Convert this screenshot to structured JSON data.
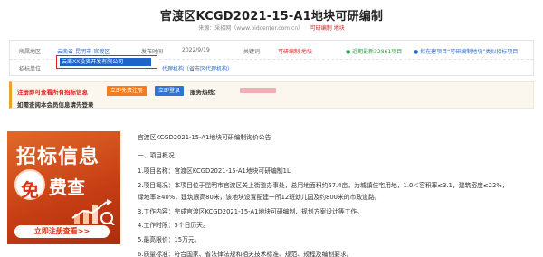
{
  "page": {
    "title": "官渡区KCGD2021-15-A1地块可研编制",
    "meta_prefix": "来源：采招网（www.bidcenter.com.cn）",
    "meta_tags": "可研编制  地块"
  },
  "info": {
    "region_label": "所属地区",
    "region_value": "云南省-昆明市-官渡区",
    "date_label": "发布时间",
    "date_value": "2022/9/19",
    "keyword_label": "关键词",
    "keyword_value": "可研编制  地块",
    "hotline_text": "近期最新32861项目",
    "recommend_text": "拟在建项目“可研编制地块”类似招标项目",
    "company_label": "招标单位",
    "company_value": "云南XX投资开发有限公司",
    "agency_text": "代理机构（省市区代理机构）"
  },
  "notice": {
    "line1_prefix": "注册即可查看所有招标信息",
    "follow_button": "立即免费注册",
    "login_button": "立即登录",
    "hotline_label": "服务热线：",
    "line2": "如需查阅本会员信息请先登录"
  },
  "ad": {
    "headline": "招标信息",
    "badge": "免",
    "headline2": "费查",
    "cta": "立即注册查看>>"
  },
  "content": {
    "heading": "官渡区KCGD2021-15-A1地块可研编制询价公告",
    "section1": "一、项目概况：",
    "item1": "1.项目名称：官渡区KCGD2021-15-A1地块可研编制1L",
    "item2a": "2.项目概况：本项目位于昆明市官渡区关上街道办事处，总用地面积约67.4亩，为城镇住宅用地，1.0＜容积率≤3.1，建筑密度≤22%，",
    "item2b": "绿地率≥40%，建筑限高80米，该地块设置配建一所12班幼儿园及约800米的市政道路。",
    "item3": "3.工作内容：完成官渡区KCGD2021-15-A1地块可研编制、规划方案设计等工作。",
    "item4": "4.工作时限：5个日历天。",
    "item5": "5.最高限价：15万元。",
    "item6": "6.质量标准：符合国家、省法律法规和相关技术标准、规范、规程及编制要求。"
  }
}
